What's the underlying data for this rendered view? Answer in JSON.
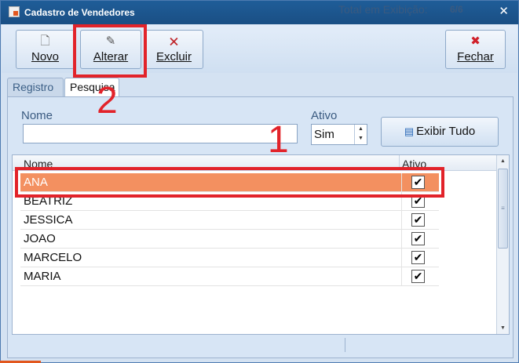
{
  "window": {
    "title": "Cadastro de Vendedores",
    "close_glyph": "✕"
  },
  "toolbar": {
    "buttons": [
      {
        "label": "Novo",
        "icon": "new-document-icon"
      },
      {
        "label": "Alterar",
        "icon": "edit-document-icon"
      },
      {
        "label": "Excluir",
        "icon": "delete-document-icon"
      },
      {
        "label": "Fechar",
        "icon": "close-x-icon"
      }
    ],
    "icons": {
      "novo": "🗋",
      "alterar": "✎",
      "excluir": "🗙",
      "fechar": "✖"
    }
  },
  "tabs": [
    {
      "label": "Registro",
      "active": false
    },
    {
      "label": "Pesquisa",
      "active": true
    }
  ],
  "filters": {
    "nome_label": "Nome",
    "nome_value": "",
    "ativo_label": "Ativo",
    "ativo_value": "Sim",
    "exibir_label": "Exibir Tudo"
  },
  "grid": {
    "columns": [
      "Nome",
      "Ativo"
    ],
    "rows": [
      {
        "nome": "ANA",
        "ativo": true,
        "selected": true
      },
      {
        "nome": "BEATRIZ",
        "ativo": true,
        "selected": false
      },
      {
        "nome": "JESSICA",
        "ativo": true,
        "selected": false
      },
      {
        "nome": "JOAO",
        "ativo": true,
        "selected": false
      },
      {
        "nome": "MARCELO",
        "ativo": true,
        "selected": false
      },
      {
        "nome": "MARIA",
        "ativo": true,
        "selected": false
      }
    ]
  },
  "status": {
    "label": "Total em Exibição:",
    "count": "6/6"
  },
  "annotations": {
    "step1": "1",
    "step2": "2",
    "color": "#e2232a"
  },
  "colors": {
    "selection": "#f39060",
    "titlebar": "#1f5d98"
  }
}
